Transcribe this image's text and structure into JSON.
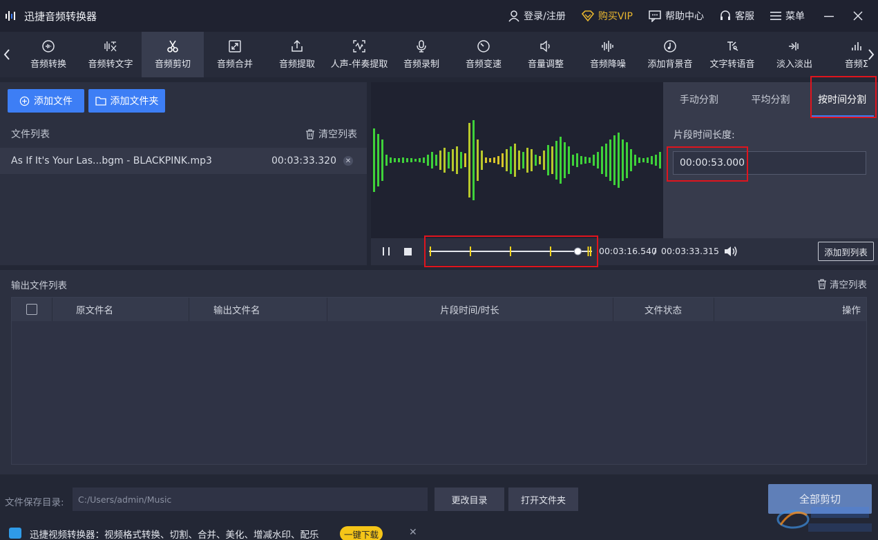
{
  "titlebar": {
    "title": "迅捷音频转换器",
    "login": "登录/注册",
    "vip": "购买VIP",
    "help": "帮助中心",
    "service": "客服",
    "menu": "菜单"
  },
  "toolbar": {
    "tools": [
      {
        "label": "音频转换",
        "icon": "audio-convert-icon"
      },
      {
        "label": "音频转文字",
        "icon": "audio-to-text-icon"
      },
      {
        "label": "音频剪切",
        "icon": "scissors-icon"
      },
      {
        "label": "音频合并",
        "icon": "merge-icon"
      },
      {
        "label": "音频提取",
        "icon": "extract-icon"
      },
      {
        "label": "人声-伴奏提取",
        "icon": "vocal-extract-icon"
      },
      {
        "label": "音频录制",
        "icon": "microphone-icon"
      },
      {
        "label": "音频变速",
        "icon": "speed-icon"
      },
      {
        "label": "音量调整",
        "icon": "volume-icon"
      },
      {
        "label": "音频降噪",
        "icon": "denoise-icon"
      },
      {
        "label": "添加背景音",
        "icon": "background-music-icon"
      },
      {
        "label": "文字转语音",
        "icon": "text-to-speech-icon"
      },
      {
        "label": "淡入淡出",
        "icon": "fade-icon"
      },
      {
        "label": "音频Σ",
        "icon": "audio-more-icon"
      }
    ],
    "active_index": 2
  },
  "left": {
    "add_file": "添加文件",
    "add_folder": "添加文件夹",
    "file_list_label": "文件列表",
    "clear_list": "清空列表",
    "files": [
      {
        "name": "As If It's Your Las...bgm - BLACKPINK.mp3",
        "duration": "00:03:33.320"
      }
    ]
  },
  "player": {
    "current_time": "00:03:16.540",
    "separator": "/",
    "total_time": "00:03:33.315",
    "add_to_list": "添加到列表",
    "playhead_fraction": 0.92
  },
  "split": {
    "tabs": [
      "手动分割",
      "平均分割",
      "按时间分割"
    ],
    "active_tab": 2,
    "segment_label": "片段时间长度:",
    "segment_value": "00:00:53.000"
  },
  "output": {
    "title": "输出文件列表",
    "clear": "清空列表",
    "columns": [
      "原文件名",
      "输出文件名",
      "片段时间/时长",
      "文件状态",
      "操作"
    ]
  },
  "bottom": {
    "save_dir_label": "文件保存目录:",
    "save_dir_value": "C:/Users/admin/Music",
    "change_dir": "更改目录",
    "open_folder": "打开文件夹",
    "cut_all": "全部剪切",
    "promo_text": "迅捷视频转换器：视频格式转换、切割、合并、美化、增减水印、配乐",
    "promo_button": "一键下载"
  },
  "colors": {
    "accent": "#3d7ef5",
    "vip": "#e8b62f",
    "highlight": "#e0141d",
    "wave_green": "#3fd23a",
    "wave_yellow": "#d8c52a"
  }
}
